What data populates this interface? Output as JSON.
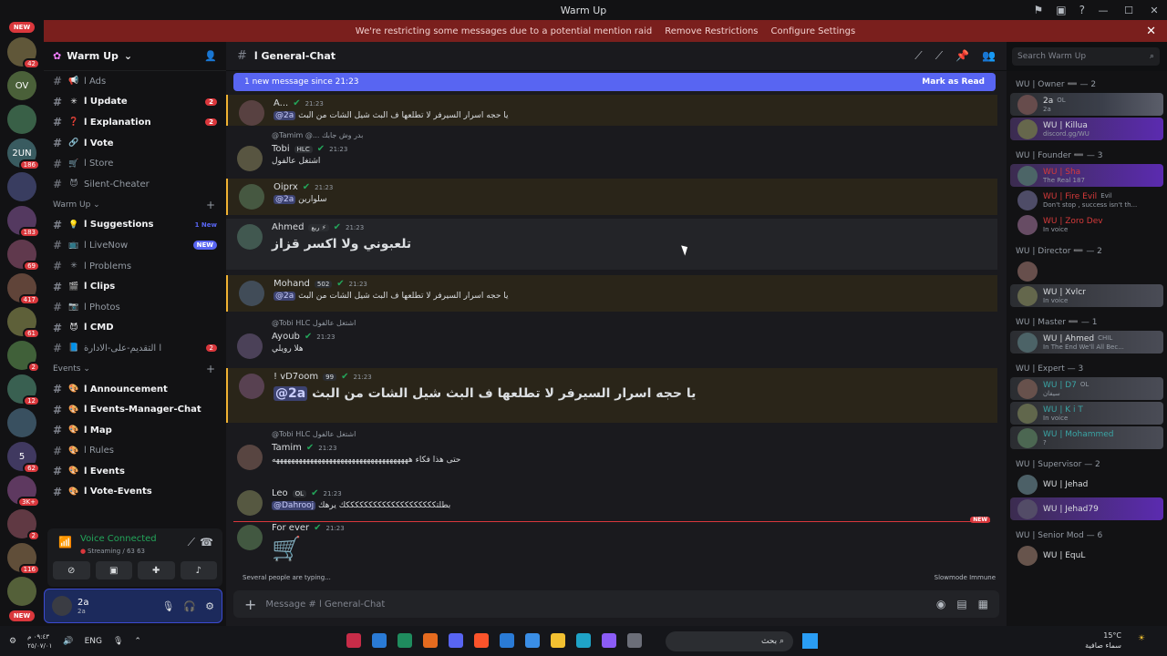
{
  "window": {
    "title": "Warm Up"
  },
  "servers": [
    {
      "label": "NEW",
      "pill": true
    },
    {
      "label": "",
      "badge": "42"
    },
    {
      "label": "OV"
    },
    {
      "label": "",
      "badge": ""
    },
    {
      "label": "2UN",
      "badge": "186"
    },
    {
      "label": "",
      "badge": ""
    },
    {
      "label": "",
      "badge": "183"
    },
    {
      "label": "",
      "badge": "69"
    },
    {
      "label": "",
      "badge": "417"
    },
    {
      "label": "",
      "badge": "61"
    },
    {
      "label": "",
      "badge": "2"
    },
    {
      "label": "",
      "badge": "12"
    },
    {
      "label": "",
      "badge": ""
    },
    {
      "label": "5",
      "badge": "62"
    },
    {
      "label": "",
      "badge": "3K+"
    },
    {
      "label": "",
      "badge": "2"
    },
    {
      "label": "",
      "badge": "116"
    },
    {
      "label": "",
      "badge": ""
    },
    {
      "label": "NEW",
      "pill": true
    }
  ],
  "banner": {
    "text": "We're restricting some messages due to a potential mention raid",
    "remove": "Remove Restrictions",
    "configure": "Configure Settings"
  },
  "guild": {
    "name": "Warm Up"
  },
  "channels_top": [
    {
      "icon": "📢",
      "name": "ا Ads",
      "bold": false
    },
    {
      "icon": "✳",
      "name": "ا Update",
      "bold": true,
      "count": "2"
    },
    {
      "icon": "❓",
      "name": "ا Explanation",
      "bold": true,
      "count": "2"
    },
    {
      "icon": "🔗",
      "name": "ا Vote",
      "bold": true
    },
    {
      "icon": "🛒",
      "name": "ا Store",
      "bold": false
    },
    {
      "icon": "😈",
      "name": "Silent-Cheater",
      "bold": false
    }
  ],
  "cat_warmup": "Warm Up",
  "channels_warmup": [
    {
      "icon": "💡",
      "name": "ا Suggestions",
      "bold": true,
      "ntext": "1 New"
    },
    {
      "icon": "📺",
      "name": "ا LiveNow",
      "bold": false,
      "newtag": "NEW"
    },
    {
      "icon": "✳",
      "name": "ا Problems",
      "bold": false
    },
    {
      "icon": "🎬",
      "name": "ا Clips",
      "bold": true
    },
    {
      "icon": "📷",
      "name": "ا Photos",
      "bold": false
    },
    {
      "icon": "😈",
      "name": "ا CMD",
      "bold": true
    },
    {
      "icon": "📘",
      "name": "ا التقديم-على-الادارة",
      "bold": false,
      "count": "2"
    }
  ],
  "cat_events": "Events",
  "channels_events": [
    {
      "icon": "🎨",
      "name": "ا Announcement",
      "bold": true
    },
    {
      "icon": "🎨",
      "name": "ا Events-Manager-Chat",
      "bold": true
    },
    {
      "icon": "🎨",
      "name": "ا Map",
      "bold": true
    },
    {
      "icon": "🎨",
      "name": "ا Rules",
      "bold": false
    },
    {
      "icon": "🎨",
      "name": "ا Events",
      "bold": true
    },
    {
      "icon": "🎨",
      "name": "ا Vote-Events",
      "bold": true
    }
  ],
  "voice": {
    "status": "Voice Connected",
    "sub": "Streaming / 63 63"
  },
  "user": {
    "name": "2a",
    "status": "2a"
  },
  "channel": {
    "name": "ا General-Chat"
  },
  "newbar": {
    "text": "1 new message since 21:23",
    "action": "Mark as Read"
  },
  "messages": [
    {
      "name": "A...",
      "time": "21:23",
      "mention": "@2a",
      "body": "يا حجه اسرار السيرفر لا تطلعها ف البث شيل الشات من البث"
    },
    {
      "reply": "@Tamim @... بدر وش جابك",
      "name": "Tobi",
      "tag": "HLC",
      "time": "21:23",
      "body": "اشتغل عالفول"
    },
    {
      "name": "Oiprx",
      "time": "21:23",
      "mention": "@2a",
      "body": "سلوارين"
    },
    {
      "name": "Ahmed",
      "tag": "ريع ⚡",
      "time": "21:23",
      "body": "تلعبوني ولا اكسر قزاز"
    },
    {
      "name": "Mohand",
      "tag": "502",
      "time": "21:23",
      "mention": "@2a",
      "body": "يا حجه اسرار السيرفر لا تطلعها ف البث شيل الشات من البث"
    },
    {
      "reply": "@Tobi HLC اشتغل عالفول",
      "name": "Ayoub",
      "time": "21:23",
      "body": "هلا رويلي"
    },
    {
      "name": "! vD7oom",
      "tag": "99",
      "time": "21:23",
      "mention": "@2a",
      "body": "يا حجه اسرار السيرفر لا تطلعها ف البث شيل الشات من البث"
    },
    {
      "reply": "@Tobi HLC اشتغل عالفول",
      "name": "Tamim",
      "time": "21:23",
      "body": "حتى هذا فكاء ههههههههههههههههههههههههههههههههههههه"
    },
    {
      "name": "Leo",
      "tag": "OL",
      "time": "21:23",
      "mention": "@Dahrooj",
      "body": "بطلتككككككككككككككككككككك يرهك"
    },
    {
      "name": "For ever",
      "time": "21:23",
      "body": "🛒"
    }
  ],
  "divider_label": "NEW",
  "typing": "Several people are typing...",
  "slowmode": "Slowmode Immune",
  "composer": {
    "placeholder": "Message # ا General-Chat"
  },
  "search": {
    "placeholder": "Search Warm Up"
  },
  "member_groups": [
    {
      "role": "WU | Owner ➖ — 2",
      "members": [
        {
          "name": "2a",
          "tag": "OL",
          "sub": "2a",
          "style": "banner1"
        },
        {
          "name": "WU | Killua",
          "sub": "discord.gg/WU",
          "style": "banner2"
        }
      ]
    },
    {
      "role": "WU | Founder ➖ — 3",
      "members": [
        {
          "name": "WU | Sha",
          "sub": "The Real 187",
          "style": "banner2",
          "red": true
        },
        {
          "name": "WU | Fire Evil",
          "tag": "Evil",
          "sub": "Don't stop , success isn't th...",
          "red": true
        },
        {
          "name": "WU | Zoro Dev",
          "sub": "In voice",
          "red": true
        }
      ]
    },
    {
      "role": "WU | Director ➖ — 2",
      "members": [
        {
          "name": "",
          "sub": ""
        },
        {
          "name": "WU | Xvlcr",
          "sub": "In voice",
          "style": "banner3"
        }
      ]
    },
    {
      "role": "WU | Master ➖ — 1",
      "members": [
        {
          "name": "WU | Ahmed",
          "tag": "CHIL",
          "sub": "In The End We'll All Bec...",
          "style": "banner3"
        }
      ]
    },
    {
      "role": "WU | Expert — 3",
      "members": [
        {
          "name": "WU | D7",
          "tag": "OL",
          "sub": "سيفان",
          "style": "banner3",
          "teal": true
        },
        {
          "name": "WU | K i T",
          "sub": "In voice",
          "style": "banner3",
          "teal": true
        },
        {
          "name": "WU | Mohammed",
          "sub": "?",
          "style": "banner3",
          "teal": true
        }
      ]
    },
    {
      "role": "WU | Supervisor — 2",
      "members": [
        {
          "name": "WU | Jehad",
          "sub": ""
        },
        {
          "name": "WU | Jehad79",
          "sub": "",
          "style": "banner2"
        }
      ]
    },
    {
      "role": "WU | Senior Mod — 6",
      "members": [
        {
          "name": "WU | EquL",
          "sub": ""
        }
      ]
    }
  ],
  "taskbar": {
    "time_date": "٠٩:٤٣ م",
    "date2": "٢٥/٠٧/٠١",
    "lang": "ENG",
    "search": "بحث",
    "weather": "15°C",
    "weather_sub": "سماء صافية"
  }
}
